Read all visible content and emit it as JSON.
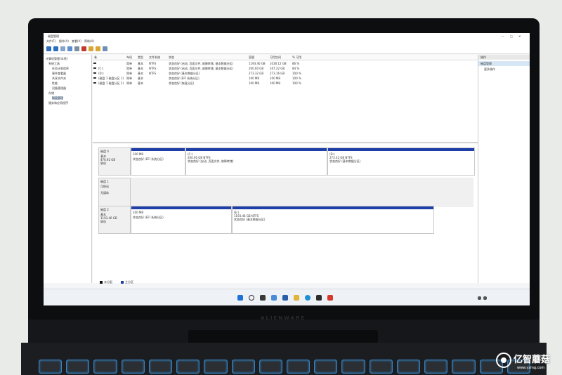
{
  "screen": {
    "window_title": "磁盘管理",
    "menu": [
      "文件(F)",
      "操作(A)",
      "查看(V)",
      "帮助(H)"
    ],
    "nav": {
      "root": "计算机管理(本地)",
      "items": [
        "系统工具",
        "任务计划程序",
        "事件查看器",
        "共享文件夹",
        "性能",
        "设备管理器",
        "存储",
        "磁盘管理",
        "服务和应用程序"
      ]
    },
    "volume_table": {
      "columns": [
        "卷",
        "布局",
        "类型",
        "文件系统",
        "状态",
        "容量",
        "可用空间",
        "% 可用"
      ],
      "rows": [
        [
          "",
          "简单",
          "基本",
          "NTFS",
          "状态良好 (启动, 页面文件, 故障转储, 基本数据分区)",
          "1193.46 GB",
          "1030.12 GB",
          "86 %"
        ],
        [
          "(C:)",
          "简单",
          "基本",
          "NTFS",
          "状态良好 (启动, 页面文件, 故障转储, 基本数据分区)",
          "200.00 GB",
          "167.22 GB",
          "84 %"
        ],
        [
          "(D:)",
          "简单",
          "基本",
          "NTFS",
          "状态良好 (基本数据分区)",
          "273.32 GB",
          "273.16 GB",
          "100 %"
        ],
        [
          "(磁盘 1 磁盘分区 1)",
          "简单",
          "基本",
          "",
          "状态良好 (EFI 系统分区)",
          "100 MB",
          "100 MB",
          "100 %"
        ],
        [
          "(磁盘 1 磁盘分区 2)",
          "简单",
          "基本",
          "",
          "状态良好 (恢复分区)",
          "100 MB",
          "100 MB",
          "100 %"
        ]
      ]
    },
    "disks": [
      {
        "label": "磁盘 0",
        "type": "基本",
        "size": "476.92 GB",
        "status": "联机",
        "partitions": [
          {
            "name": "",
            "size": "100 MB",
            "status": "状态良好 (EFI 系统分区)"
          },
          {
            "name": "(C:)",
            "size": "200.00 GB NTFS",
            "status": "状态良好 (启动, 页面文件, 故障转储)"
          },
          {
            "name": "(D:)",
            "size": "273.32 GB NTFS",
            "status": "状态良好 (基本数据分区)"
          }
        ]
      },
      {
        "label": "磁盘 1",
        "type": "可移动",
        "size": "",
        "status": "无媒体",
        "partitions": []
      },
      {
        "label": "磁盘 2",
        "type": "基本",
        "size": "1193.46 GB",
        "status": "联机",
        "partitions": [
          {
            "name": "",
            "size": "100 MB",
            "status": "状态良好 (EFI 系统分区)"
          },
          {
            "name": "(E:)",
            "size": "1193.46 GB NTFS",
            "status": "状态良好 (基本数据分区)"
          }
        ]
      }
    ],
    "legend": [
      "未分配",
      "主分区"
    ],
    "actions": {
      "header": "操作",
      "selected": "磁盘管理",
      "more": "更多操作"
    },
    "tray_time": "",
    "colors": {
      "partition_bar": "#1f3fa8",
      "selected_action": "#d7e6f5"
    }
  },
  "laptop": {
    "brand_text": "ALIENWARE"
  },
  "watermark": {
    "text": "亿智蘑菇",
    "url": "www.yzmg.com"
  }
}
